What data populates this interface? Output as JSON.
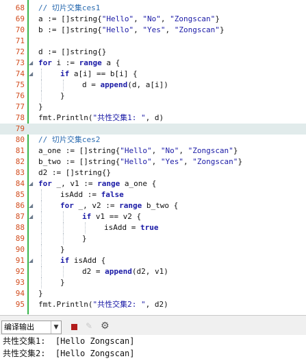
{
  "editor": {
    "lines": [
      {
        "n": "68",
        "fold": "",
        "segs": [
          {
            "c": "cm",
            "t": "// 切片交集ces1"
          }
        ],
        "indent": 1,
        "hl": false
      },
      {
        "n": "69",
        "fold": "",
        "segs": [
          {
            "c": "",
            "t": "a := []string{"
          },
          {
            "c": "str",
            "t": "\"Hello\""
          },
          {
            "c": "",
            "t": ", "
          },
          {
            "c": "str",
            "t": "\"No\""
          },
          {
            "c": "",
            "t": ", "
          },
          {
            "c": "str",
            "t": "\"Zongscan\""
          },
          {
            "c": "",
            "t": "}"
          }
        ],
        "indent": 1,
        "hl": false
      },
      {
        "n": "70",
        "fold": "",
        "segs": [
          {
            "c": "",
            "t": "b := []string{"
          },
          {
            "c": "str",
            "t": "\"Hello\""
          },
          {
            "c": "",
            "t": ", "
          },
          {
            "c": "str",
            "t": "\"Yes\""
          },
          {
            "c": "",
            "t": ", "
          },
          {
            "c": "str",
            "t": "\"Zongscan\""
          },
          {
            "c": "",
            "t": "}"
          }
        ],
        "indent": 1,
        "hl": false
      },
      {
        "n": "71",
        "fold": "",
        "segs": [],
        "indent": 0,
        "hl": false
      },
      {
        "n": "72",
        "fold": "",
        "segs": [
          {
            "c": "",
            "t": "d := []string{}"
          }
        ],
        "indent": 1,
        "hl": false
      },
      {
        "n": "73",
        "fold": "◢",
        "segs": [
          {
            "c": "kw",
            "t": "for"
          },
          {
            "c": "",
            "t": " i := "
          },
          {
            "c": "kw",
            "t": "range"
          },
          {
            "c": "",
            "t": " a {"
          }
        ],
        "indent": 1,
        "hl": false
      },
      {
        "n": "74",
        "fold": "◢",
        "segs": [
          {
            "c": "kw",
            "t": "if"
          },
          {
            "c": "",
            "t": " a[i] == b[i] {"
          }
        ],
        "indent": 2,
        "hl": false
      },
      {
        "n": "75",
        "fold": "",
        "segs": [
          {
            "c": "",
            "t": "d = "
          },
          {
            "c": "kw",
            "t": "append"
          },
          {
            "c": "",
            "t": "(d, a[i])"
          }
        ],
        "indent": 3,
        "hl": false
      },
      {
        "n": "76",
        "fold": "",
        "segs": [
          {
            "c": "",
            "t": "}"
          }
        ],
        "indent": 2,
        "hl": false
      },
      {
        "n": "77",
        "fold": "",
        "segs": [
          {
            "c": "",
            "t": "}"
          }
        ],
        "indent": 1,
        "hl": false
      },
      {
        "n": "78",
        "fold": "",
        "segs": [
          {
            "c": "",
            "t": "fmt.Println("
          },
          {
            "c": "str",
            "t": "\"共性交集1: \""
          },
          {
            "c": "",
            "t": ", d)"
          }
        ],
        "indent": 1,
        "hl": false
      },
      {
        "n": "79",
        "fold": "",
        "segs": [],
        "indent": 0,
        "hl": true
      },
      {
        "n": "80",
        "fold": "",
        "segs": [
          {
            "c": "cm",
            "t": "// 切片交集ces2"
          }
        ],
        "indent": 1,
        "hl": false
      },
      {
        "n": "81",
        "fold": "",
        "segs": [
          {
            "c": "",
            "t": "a_one := []string{"
          },
          {
            "c": "str",
            "t": "\"Hello\""
          },
          {
            "c": "",
            "t": ", "
          },
          {
            "c": "str",
            "t": "\"No\""
          },
          {
            "c": "",
            "t": ", "
          },
          {
            "c": "str",
            "t": "\"Zongscan\""
          },
          {
            "c": "",
            "t": "}"
          }
        ],
        "indent": 1,
        "hl": false
      },
      {
        "n": "82",
        "fold": "",
        "segs": [
          {
            "c": "",
            "t": "b_two := []string{"
          },
          {
            "c": "str",
            "t": "\"Hello\""
          },
          {
            "c": "",
            "t": ", "
          },
          {
            "c": "str",
            "t": "\"Yes\""
          },
          {
            "c": "",
            "t": ", "
          },
          {
            "c": "str",
            "t": "\"Zongscan\""
          },
          {
            "c": "",
            "t": "}"
          }
        ],
        "indent": 1,
        "hl": false
      },
      {
        "n": "83",
        "fold": "",
        "segs": [
          {
            "c": "",
            "t": "d2 := []string{}"
          }
        ],
        "indent": 1,
        "hl": false
      },
      {
        "n": "84",
        "fold": "◢",
        "segs": [
          {
            "c": "kw",
            "t": "for"
          },
          {
            "c": "",
            "t": " _, v1 := "
          },
          {
            "c": "kw",
            "t": "range"
          },
          {
            "c": "",
            "t": " a_one {"
          }
        ],
        "indent": 1,
        "hl": false
      },
      {
        "n": "85",
        "fold": "",
        "segs": [
          {
            "c": "",
            "t": "isAdd := "
          },
          {
            "c": "kw",
            "t": "false"
          }
        ],
        "indent": 2,
        "hl": false
      },
      {
        "n": "86",
        "fold": "◢",
        "segs": [
          {
            "c": "kw",
            "t": "for"
          },
          {
            "c": "",
            "t": " _, v2 := "
          },
          {
            "c": "kw",
            "t": "range"
          },
          {
            "c": "",
            "t": " b_two {"
          }
        ],
        "indent": 2,
        "hl": false
      },
      {
        "n": "87",
        "fold": "◢",
        "segs": [
          {
            "c": "kw",
            "t": "if"
          },
          {
            "c": "",
            "t": " v1 == v2 {"
          }
        ],
        "indent": 3,
        "hl": false
      },
      {
        "n": "88",
        "fold": "",
        "segs": [
          {
            "c": "",
            "t": "isAdd = "
          },
          {
            "c": "kw",
            "t": "true"
          }
        ],
        "indent": 4,
        "hl": false
      },
      {
        "n": "89",
        "fold": "",
        "segs": [
          {
            "c": "",
            "t": "}"
          }
        ],
        "indent": 3,
        "hl": false
      },
      {
        "n": "90",
        "fold": "",
        "segs": [
          {
            "c": "",
            "t": "}"
          }
        ],
        "indent": 2,
        "hl": false
      },
      {
        "n": "91",
        "fold": "◢",
        "segs": [
          {
            "c": "kw",
            "t": "if"
          },
          {
            "c": "",
            "t": " isAdd {"
          }
        ],
        "indent": 2,
        "hl": false
      },
      {
        "n": "92",
        "fold": "",
        "segs": [
          {
            "c": "",
            "t": "d2 = "
          },
          {
            "c": "kw",
            "t": "append"
          },
          {
            "c": "",
            "t": "(d2, v1)"
          }
        ],
        "indent": 3,
        "hl": false
      },
      {
        "n": "93",
        "fold": "",
        "segs": [
          {
            "c": "",
            "t": "}"
          }
        ],
        "indent": 2,
        "hl": false
      },
      {
        "n": "94",
        "fold": "",
        "segs": [
          {
            "c": "",
            "t": "}"
          }
        ],
        "indent": 1,
        "hl": false
      },
      {
        "n": "95",
        "fold": "",
        "segs": [
          {
            "c": "",
            "t": "fmt.Println("
          },
          {
            "c": "str",
            "t": "\"共性交集2: \""
          },
          {
            "c": "",
            "t": ", d2)"
          }
        ],
        "indent": 1,
        "hl": false
      }
    ]
  },
  "toolbar": {
    "panel_select": "编译输出",
    "select_arrow_icon": "chevron-down-icon",
    "stop_icon": "stop-icon",
    "clear_icon": "eraser-icon",
    "settings_icon": "gear-icon"
  },
  "output": {
    "lines": [
      "共性交集1:  [Hello Zongscan]",
      "共性交集2:  [Hello Zongscan]"
    ]
  }
}
